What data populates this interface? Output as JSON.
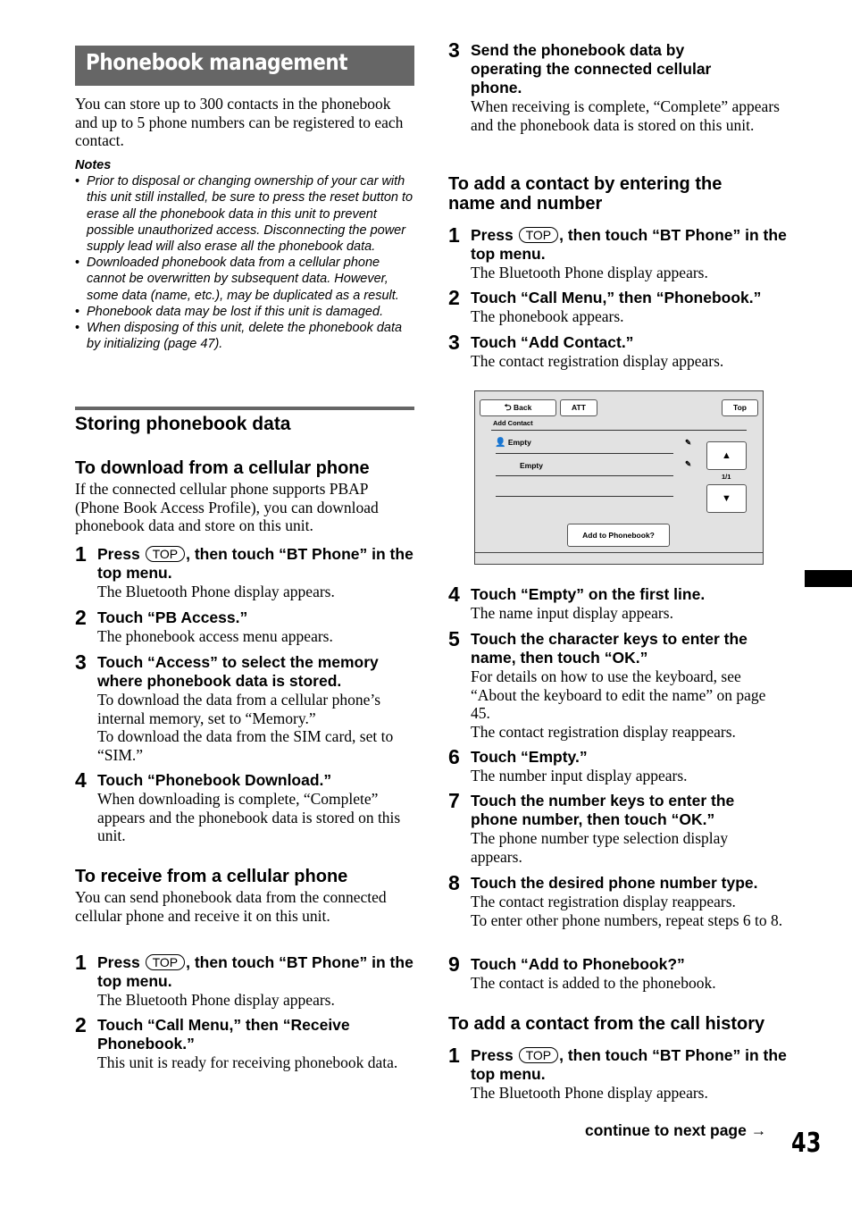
{
  "page": {
    "title": "Phonebook management",
    "intro": "You can store up to 300 contacts in the phonebook and up to 5 phone numbers can be registered to each contact.",
    "notes": {
      "header": "Notes",
      "items": [
        "Prior to disposal or changing ownership of your car with this unit still installed, be sure to press the reset button to erase all the phonebook data in this unit to prevent possible unauthorized access. Disconnecting the power supply lead will also erase all the phonebook data.",
        "Downloaded phonebook data from a cellular phone cannot be overwritten by subsequent data. However, some data (name, etc.), may be duplicated as a result.",
        "Phonebook data may be lost if this unit is damaged.",
        "When disposing of this unit, delete the phonebook data by initializing (page 47)."
      ]
    },
    "section_title": "Storing phonebook data",
    "download": {
      "heading": "To download from a cellular phone",
      "intro": "If the connected cellular phone supports PBAP (Phone Book Access Profile), you can download phonebook data and store on this unit.",
      "steps": [
        {
          "num": "1",
          "head_pre": "Press",
          "key": "TOP",
          "head_post": ", then touch “BT Phone” in the top menu.",
          "body": "The Bluetooth Phone display appears."
        },
        {
          "num": "2",
          "head": "Touch “PB Access.”",
          "body": "The phonebook access menu appears."
        },
        {
          "num": "3",
          "head": "Touch “Access” to select the memory where phonebook data is stored.",
          "body": "To download the data from a cellular phone’s internal memory, set to “Memory.”",
          "body2": "To download the data from the SIM card, set to “SIM.”"
        },
        {
          "num": "4",
          "head": "Touch “Phonebook Download.”",
          "body": "When downloading is complete, “Complete” appears and the phonebook data is stored on this unit."
        }
      ]
    },
    "receive": {
      "heading": "To receive from a cellular phone",
      "intro": "You can send phonebook data from the connected cellular phone and receive it on this unit.",
      "steps": [
        {
          "num": "1",
          "head_pre": "Press",
          "key": "TOP",
          "head_post": ", then touch “BT Phone” in the top menu.",
          "body": "The Bluetooth Phone display appears."
        },
        {
          "num": "2",
          "head": "Touch “Call Menu,” then “Receive Phonebook.”",
          "body": "This unit is ready for receiving phonebook data."
        },
        {
          "num": "3",
          "head": "Send the phonebook data by operating the connected cellular phone.",
          "body": "When receiving is complete, “Complete” appears and the phonebook data is stored on this unit."
        }
      ]
    },
    "add_manual": {
      "heading": "To add a contact by entering the name and number",
      "steps": [
        {
          "num": "1",
          "head_pre": "Press",
          "key": "TOP",
          "head_post": ", then touch “BT Phone” in the top menu.",
          "body": "The Bluetooth Phone display appears."
        },
        {
          "num": "2",
          "head": "Touch “Call Menu,” then “Phonebook.”",
          "body": "The phonebook appears."
        },
        {
          "num": "3",
          "head": "Touch “Add Contact.”",
          "body": "The contact registration display appears."
        },
        {
          "num": "4",
          "head": "Touch “Empty” on the first line.",
          "body": "The name input display appears."
        },
        {
          "num": "5",
          "head": "Touch the character keys to enter the name, then touch “OK.”",
          "body": "For details on how to use the keyboard, see “About the keyboard to edit the name” on page 45.",
          "body2": "The contact registration display reappears."
        },
        {
          "num": "6",
          "head": "Touch “Empty.”",
          "body": "The number input display appears."
        },
        {
          "num": "7",
          "head": "Touch the number keys to enter the phone number, then touch “OK.”",
          "body": "The phone number type selection display appears."
        },
        {
          "num": "8",
          "head": "Touch the desired phone number type.",
          "body": "The contact registration display reappears.",
          "body2": "To enter other phone numbers, repeat steps 6 to 8."
        },
        {
          "num": "9",
          "head": "Touch “Add to Phonebook?”",
          "body": "The contact is added to the phonebook."
        }
      ]
    },
    "add_history": {
      "heading": "To add a contact from the call history",
      "steps": [
        {
          "num": "1",
          "head_pre": "Press",
          "key": "TOP",
          "head_post": ", then touch “BT Phone” in the top menu.",
          "body": "The Bluetooth Phone display appears."
        }
      ]
    },
    "continue_text": "continue to next page →",
    "page_number": "43"
  },
  "screen": {
    "back_label": "Back",
    "att_label": "ATT",
    "top_label": "Top",
    "screen_title": "Add Contact",
    "name_value": "Empty",
    "number_value": "Empty",
    "page_indicator": "1/1",
    "up_arrow": "▲",
    "down_arrow": "▼",
    "add_button": "Add to Phonebook?"
  }
}
